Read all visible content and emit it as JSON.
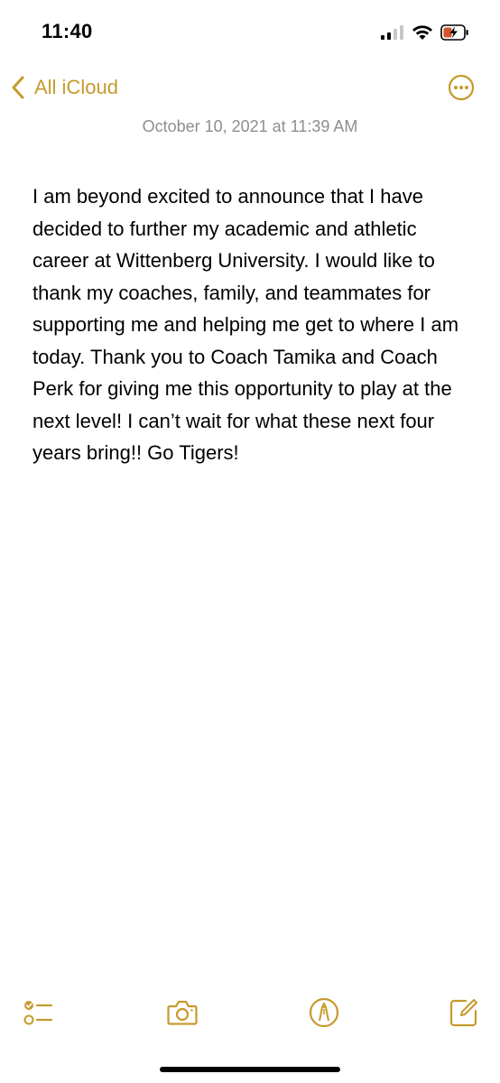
{
  "status_bar": {
    "time": "11:40"
  },
  "nav": {
    "back_label": "All iCloud"
  },
  "note": {
    "date": "October 10, 2021 at 11:39 AM",
    "body": "I am beyond excited to announce that I have decided to further my academic and athletic career at Wittenberg University. I would like to thank my coaches, family, and teammates for supporting me and helping me get to where I am today. Thank you to Coach Tamika and Coach Perk for giving me this opportunity to play at the next level! I can’t wait for what these next four years bring!! Go Tigers!"
  },
  "toolbar": {
    "items": [
      "checklist-icon",
      "camera-icon",
      "markup-pen-icon",
      "compose-icon"
    ]
  },
  "colors": {
    "accent": "#c69a2d",
    "date_text": "#8e8e93",
    "battery_fill": "#d4552a"
  }
}
